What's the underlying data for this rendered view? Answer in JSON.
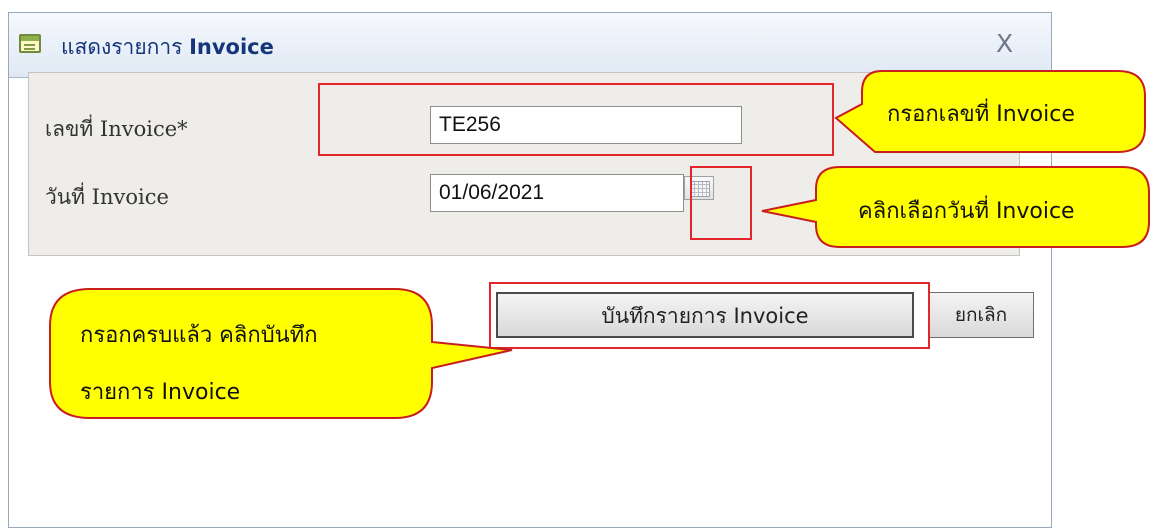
{
  "window": {
    "title_prefix": "แสดงรายการ ",
    "title_bold": "Invoice",
    "close_glyph": "X"
  },
  "form": {
    "invoice_no_label": "เลขที่ Invoice*",
    "invoice_no_value": "TE256",
    "invoice_date_label": "วันที่ Invoice",
    "invoice_date_value": "01/06/2021"
  },
  "buttons": {
    "save_label": "บันทึกรายการ Invoice",
    "cancel_label": "ยกเลิก"
  },
  "annotations": {
    "invoice_no_hint": "กรอกเลขที่ Invoice",
    "date_hint": "คลิกเลือกวันที่ Invoice",
    "save_hint_line1": "กรอกครบแล้ว คลิกบันทึก",
    "save_hint_line2": "รายการ Invoice"
  },
  "colors": {
    "callout_fill": "#ffff00",
    "callout_border": "#c81e1e",
    "highlight_border": "#e3262b",
    "title_text": "#15367a"
  }
}
